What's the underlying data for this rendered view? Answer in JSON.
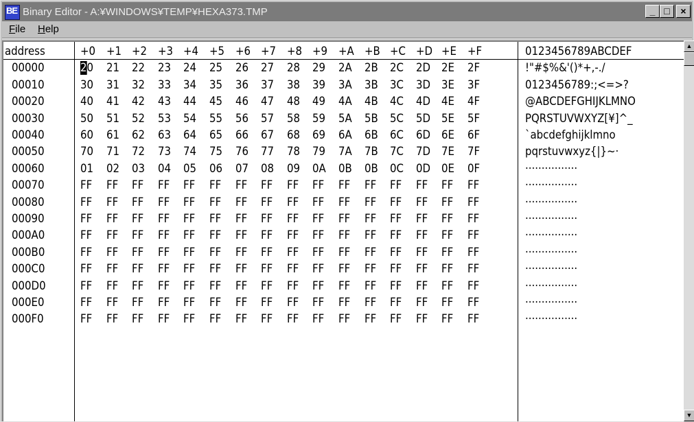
{
  "window": {
    "title": "Binary Editor - A:¥WINDOWS¥TEMP¥HEXA373.TMP",
    "icon_label": "BE",
    "minimize_label": "_",
    "maximize_label": "□",
    "close_label": "×"
  },
  "menu": {
    "items": [
      {
        "label": "File",
        "accel": "F",
        "rest": "ile"
      },
      {
        "label": "Help",
        "accel": "H",
        "rest": "elp"
      }
    ]
  },
  "table": {
    "address_header": "address",
    "column_headers": [
      "+0",
      "+1",
      "+2",
      "+3",
      "+4",
      "+5",
      "+6",
      "+7",
      "+8",
      "+9",
      "+A",
      "+B",
      "+C",
      "+D",
      "+E",
      "+F"
    ],
    "ascii_header": "0123456789ABCDEF",
    "rows": [
      {
        "address": "00000",
        "bytes": [
          "20",
          "21",
          "22",
          "23",
          "24",
          "25",
          "26",
          "27",
          "28",
          "29",
          "2A",
          "2B",
          "2C",
          "2D",
          "2E",
          "2F"
        ],
        "ascii": " !\"#$%&'()*+,-./"
      },
      {
        "address": "00010",
        "bytes": [
          "30",
          "31",
          "32",
          "33",
          "34",
          "35",
          "36",
          "37",
          "38",
          "39",
          "3A",
          "3B",
          "3C",
          "3D",
          "3E",
          "3F"
        ],
        "ascii": "0123456789:;<=>?"
      },
      {
        "address": "00020",
        "bytes": [
          "40",
          "41",
          "42",
          "43",
          "44",
          "45",
          "46",
          "47",
          "48",
          "49",
          "4A",
          "4B",
          "4C",
          "4D",
          "4E",
          "4F"
        ],
        "ascii": "@ABCDEFGHIJKLMNO"
      },
      {
        "address": "00030",
        "bytes": [
          "50",
          "51",
          "52",
          "53",
          "54",
          "55",
          "56",
          "57",
          "58",
          "59",
          "5A",
          "5B",
          "5C",
          "5D",
          "5E",
          "5F"
        ],
        "ascii": "PQRSTUVWXYZ[¥]^_"
      },
      {
        "address": "00040",
        "bytes": [
          "60",
          "61",
          "62",
          "63",
          "64",
          "65",
          "66",
          "67",
          "68",
          "69",
          "6A",
          "6B",
          "6C",
          "6D",
          "6E",
          "6F"
        ],
        "ascii": "`abcdefghijklmno"
      },
      {
        "address": "00050",
        "bytes": [
          "70",
          "71",
          "72",
          "73",
          "74",
          "75",
          "76",
          "77",
          "78",
          "79",
          "7A",
          "7B",
          "7C",
          "7D",
          "7E",
          "7F"
        ],
        "ascii": "pqrstuvwxyz{|}~·"
      },
      {
        "address": "00060",
        "bytes": [
          "01",
          "02",
          "03",
          "04",
          "05",
          "06",
          "07",
          "08",
          "09",
          "0A",
          "0B",
          "0B",
          "0C",
          "0D",
          "0E",
          "0F"
        ],
        "ascii": "················"
      },
      {
        "address": "00070",
        "bytes": [
          "FF",
          "FF",
          "FF",
          "FF",
          "FF",
          "FF",
          "FF",
          "FF",
          "FF",
          "FF",
          "FF",
          "FF",
          "FF",
          "FF",
          "FF",
          "FF"
        ],
        "ascii": "················"
      },
      {
        "address": "00080",
        "bytes": [
          "FF",
          "FF",
          "FF",
          "FF",
          "FF",
          "FF",
          "FF",
          "FF",
          "FF",
          "FF",
          "FF",
          "FF",
          "FF",
          "FF",
          "FF",
          "FF"
        ],
        "ascii": "················"
      },
      {
        "address": "00090",
        "bytes": [
          "FF",
          "FF",
          "FF",
          "FF",
          "FF",
          "FF",
          "FF",
          "FF",
          "FF",
          "FF",
          "FF",
          "FF",
          "FF",
          "FF",
          "FF",
          "FF"
        ],
        "ascii": "················"
      },
      {
        "address": "000A0",
        "bytes": [
          "FF",
          "FF",
          "FF",
          "FF",
          "FF",
          "FF",
          "FF",
          "FF",
          "FF",
          "FF",
          "FF",
          "FF",
          "FF",
          "FF",
          "FF",
          "FF"
        ],
        "ascii": "················"
      },
      {
        "address": "000B0",
        "bytes": [
          "FF",
          "FF",
          "FF",
          "FF",
          "FF",
          "FF",
          "FF",
          "FF",
          "FF",
          "FF",
          "FF",
          "FF",
          "FF",
          "FF",
          "FF",
          "FF"
        ],
        "ascii": "················"
      },
      {
        "address": "000C0",
        "bytes": [
          "FF",
          "FF",
          "FF",
          "FF",
          "FF",
          "FF",
          "FF",
          "FF",
          "FF",
          "FF",
          "FF",
          "FF",
          "FF",
          "FF",
          "FF",
          "FF"
        ],
        "ascii": "················"
      },
      {
        "address": "000D0",
        "bytes": [
          "FF",
          "FF",
          "FF",
          "FF",
          "FF",
          "FF",
          "FF",
          "FF",
          "FF",
          "FF",
          "FF",
          "FF",
          "FF",
          "FF",
          "FF",
          "FF"
        ],
        "ascii": "················"
      },
      {
        "address": "000E0",
        "bytes": [
          "FF",
          "FF",
          "FF",
          "FF",
          "FF",
          "FF",
          "FF",
          "FF",
          "FF",
          "FF",
          "FF",
          "FF",
          "FF",
          "FF",
          "FF",
          "FF"
        ],
        "ascii": "················"
      },
      {
        "address": "000F0",
        "bytes": [
          "FF",
          "FF",
          "FF",
          "FF",
          "FF",
          "FF",
          "FF",
          "FF",
          "FF",
          "FF",
          "FF",
          "FF",
          "FF",
          "FF",
          "FF",
          "FF"
        ],
        "ascii": "················"
      }
    ]
  },
  "cursor": {
    "row": 0,
    "column": 0
  },
  "colors": {
    "titlebar": "#7b7b7b",
    "cursor": "#000000",
    "background": "#ffffff"
  },
  "icons": {
    "scroll_up": "up-arrow-icon",
    "scroll_down": "down-arrow-icon"
  }
}
